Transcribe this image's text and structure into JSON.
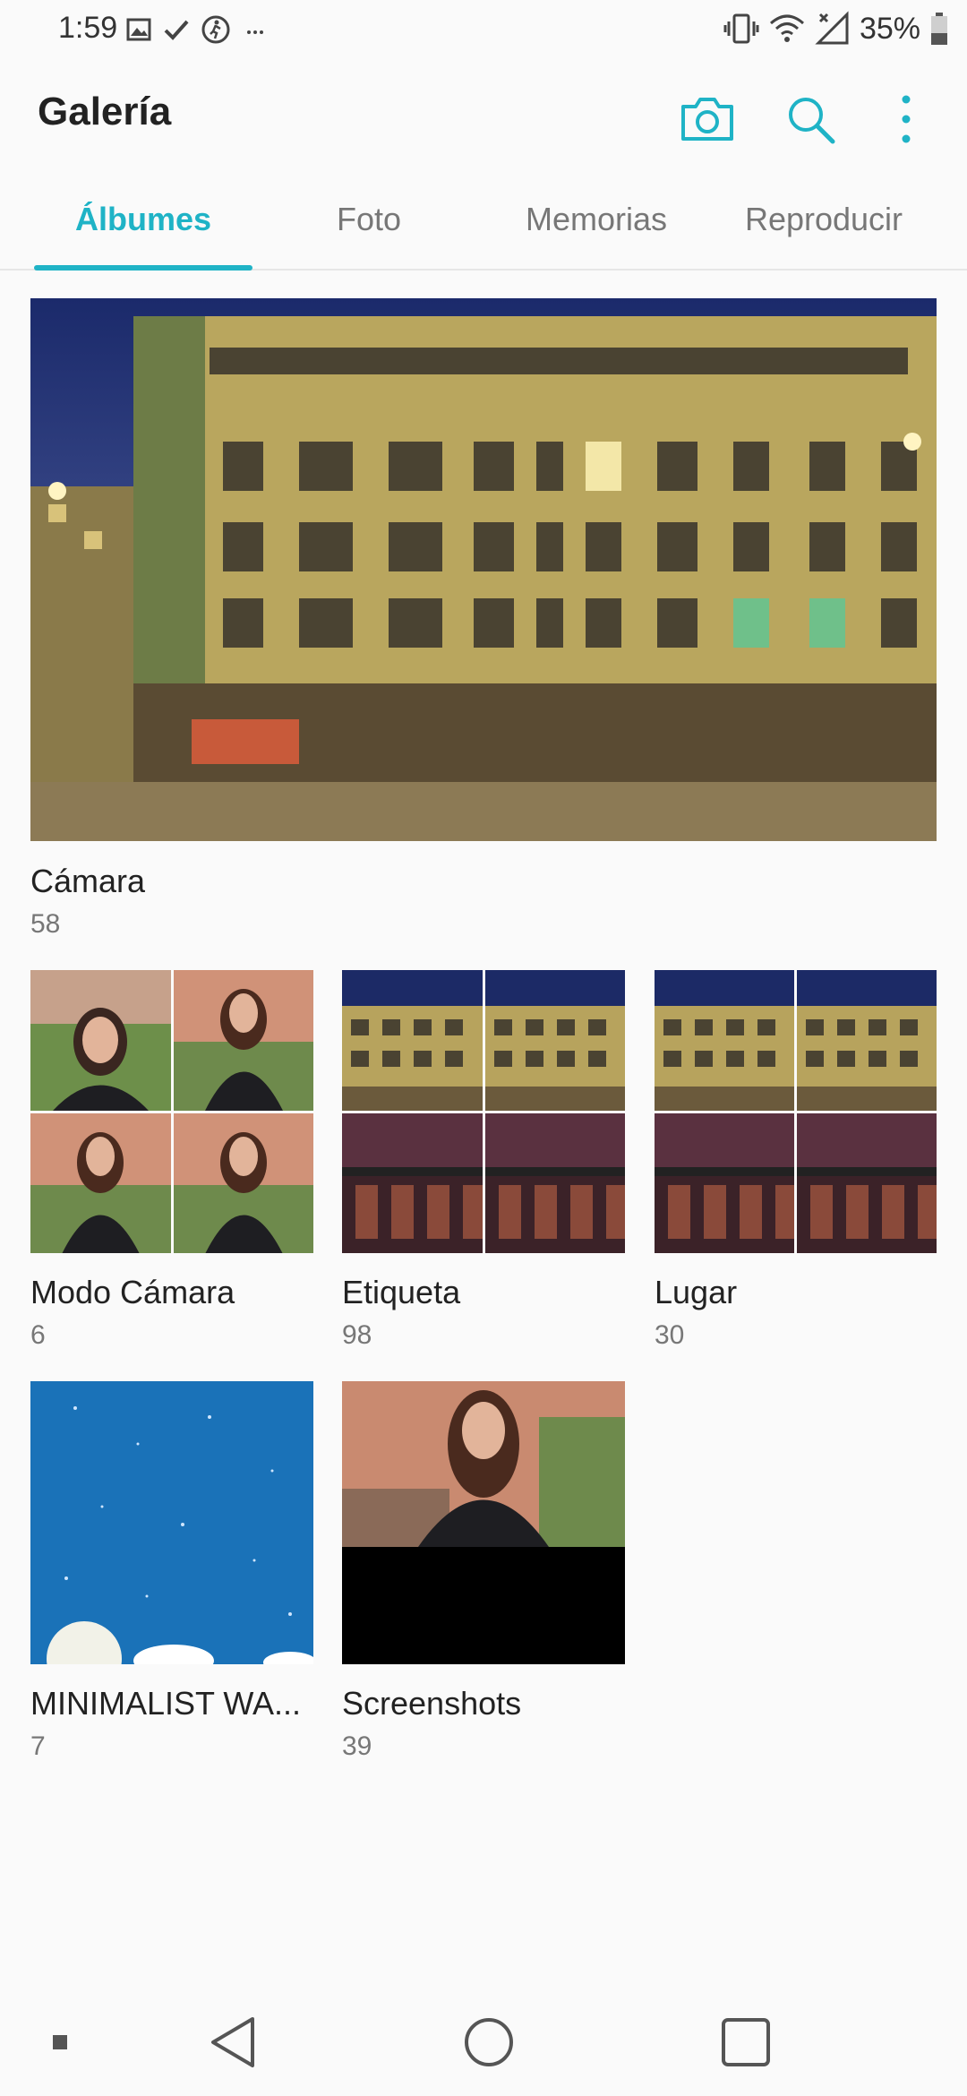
{
  "status_bar": {
    "time": "1:59",
    "battery_percent": "35%",
    "left_icons": [
      "image-icon",
      "check-icon",
      "walking-icon",
      "more-dots-icon"
    ],
    "right_icons": [
      "vibrate-icon",
      "wifi-icon",
      "signal-icon",
      "battery-icon"
    ]
  },
  "header": {
    "title": "Galería",
    "actions": [
      "camera-icon",
      "search-icon",
      "more-vert-icon"
    ],
    "accent_color": "#1fb3c6"
  },
  "tabs": [
    {
      "label": "Álbumes",
      "active": true
    },
    {
      "label": "Foto",
      "active": false
    },
    {
      "label": "Memorias",
      "active": false
    },
    {
      "label": "Reproducir",
      "active": false
    }
  ],
  "albums": [
    {
      "title": "Cámara",
      "count": "58"
    },
    {
      "title": "Modo Cámara",
      "count": "6"
    },
    {
      "title": "Etiqueta",
      "count": "98"
    },
    {
      "title": "Lugar",
      "count": "30"
    },
    {
      "title": "MINIMALIST WA...",
      "count": "7"
    },
    {
      "title": "Screenshots",
      "count": "39"
    }
  ],
  "nav_bar": {
    "buttons": [
      "small-square-icon",
      "back-icon",
      "home-icon",
      "recents-icon"
    ]
  }
}
